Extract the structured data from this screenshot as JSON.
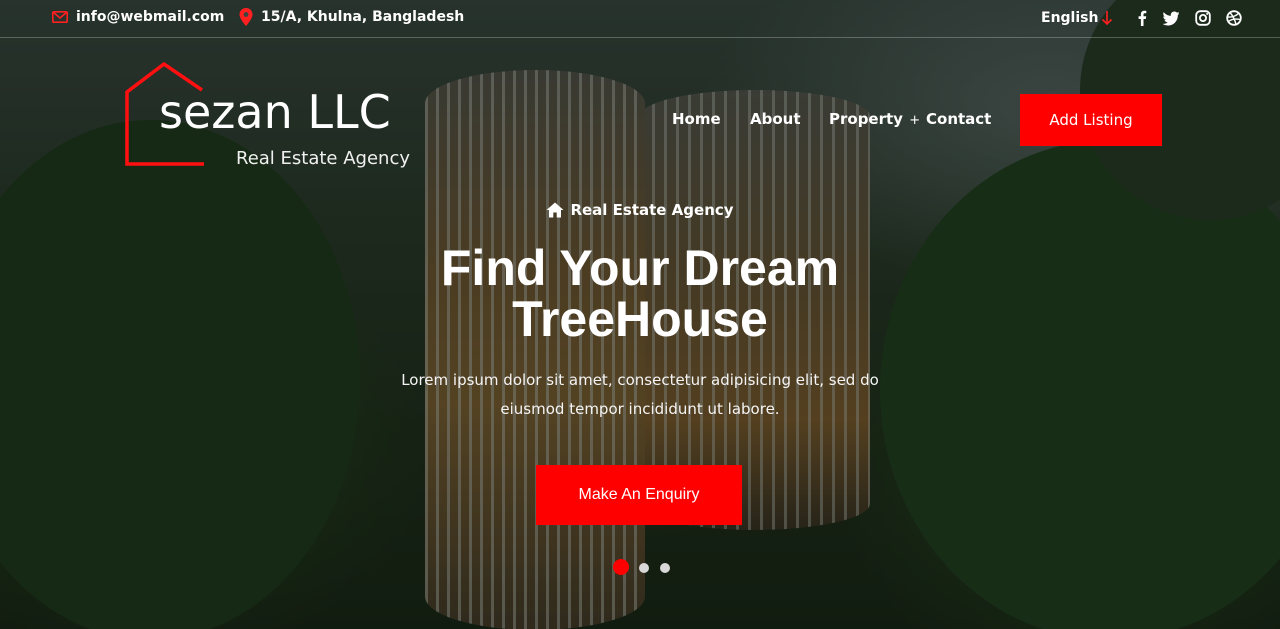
{
  "topbar": {
    "email": "info@webmail.com",
    "address": "15/A, Khulna, Bangladesh",
    "language": "English",
    "social_icons": [
      "facebook-icon",
      "twitter-icon",
      "instagram-icon",
      "dribbble-icon"
    ]
  },
  "brand": {
    "name": "sezan LLC",
    "tagline": "Real Estate Agency",
    "accent_color": "#ff0000"
  },
  "nav": {
    "items": [
      {
        "label": "Home"
      },
      {
        "label": "About"
      },
      {
        "label": "Property",
        "suffix": "+"
      },
      {
        "label": "Contact"
      }
    ],
    "cta_label": "Add Listing"
  },
  "hero": {
    "kicker": "Real Estate Agency",
    "headline_line1": "Find Your Dream",
    "headline_line2": "TreeHouse",
    "lead": "Lorem ipsum dolor sit amet, consectetur adipisicing elit, sed do eiusmod tempor incididunt ut labore.",
    "cta_label": "Make An Enquiry",
    "slides": {
      "count": 3,
      "active": 1
    }
  }
}
